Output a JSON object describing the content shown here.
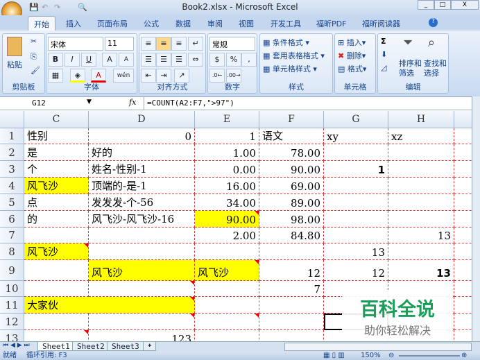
{
  "window": {
    "title": "Book2.xlsx - Microsoft Excel",
    "min": "_",
    "max": "□",
    "close": "X"
  },
  "tabs": [
    {
      "label": "开始",
      "active": true
    },
    {
      "label": "插入"
    },
    {
      "label": "页面布局"
    },
    {
      "label": "公式"
    },
    {
      "label": "数据"
    },
    {
      "label": "审阅"
    },
    {
      "label": "视图"
    },
    {
      "label": "开发工具"
    },
    {
      "label": "福昕PDF"
    },
    {
      "label": "福昕阅读器"
    }
  ],
  "ribbon": {
    "clipboard": {
      "label": "剪贴板",
      "paste": "粘贴"
    },
    "font": {
      "label": "字体",
      "name": "宋体",
      "size": "11",
      "bold": "B",
      "italic": "I",
      "underline": "U",
      "grow": "A",
      "shrink": "A",
      "color": "A",
      "phonetic": "wén"
    },
    "align": {
      "label": "对齐方式"
    },
    "number": {
      "label": "数字",
      "format": "常规",
      "percent": "%",
      "comma": ","
    },
    "styles": {
      "label": "样式",
      "cond": "条件格式",
      "table": "套用表格格式",
      "cell": "单元格样式"
    },
    "cells": {
      "label": "单元格",
      "insert": "插入",
      "delete": "删除",
      "format": "格式"
    },
    "editing": {
      "label": "编辑",
      "sum": "Σ",
      "sort1": "排序和",
      "sort2": "筛选",
      "find1": "查找和",
      "find2": "选择"
    }
  },
  "formula_bar": {
    "name_box": "G12",
    "fx": "fx",
    "formula": "=COUNT(A2:F7,\">97\")"
  },
  "columns": [
    "C",
    "D",
    "E",
    "F",
    "G",
    "H"
  ],
  "rows": [
    "1",
    "2",
    "3",
    "4",
    "5",
    "6",
    "7",
    "8",
    "9",
    "10",
    "11",
    "12",
    "13"
  ],
  "cells": {
    "C1": "性别",
    "D1": "0",
    "E1": "1",
    "F1": "语文",
    "G1": "xy",
    "H1": "xz",
    "C2": "是",
    "D2": "好的",
    "E2": "1.00",
    "F2": "78.00",
    "C3": "个",
    "D3": "姓名-性别-1",
    "E3": "0.00",
    "F3": "90.00",
    "G3": "1",
    "C4": "风飞沙",
    "D4": "顶端的-是-1",
    "E4": "16.00",
    "F4": "69.00",
    "C5": "点",
    "D5": "发发发-个-56",
    "E5": "34.00",
    "F5": "89.00",
    "C6": "的",
    "D6": "风飞沙-风飞沙-16",
    "E6": "90.00",
    "F6": "98.00",
    "E7": "2.00",
    "F7": "84.80",
    "H7": "13",
    "C8": "风飞沙",
    "G8": "13",
    "D9": "风飞沙",
    "E9": "风飞沙",
    "F9": "12",
    "G9": "12",
    "H9": "13",
    "F10": "7",
    "C11": "大家伙",
    "D13": "123"
  },
  "sheets": [
    "Sheet1",
    "Sheet2",
    "Sheet3"
  ],
  "status": {
    "ready": "就绪",
    "circular": "循环引用: F3",
    "zoom": "150%"
  },
  "watermark": {
    "title": "百科全说",
    "subtitle": "助你轻松解决"
  },
  "colors": {
    "fill_highlight": "#ffff00",
    "gridline": "#e03a3a",
    "ribbon": "#c4d7ef"
  }
}
